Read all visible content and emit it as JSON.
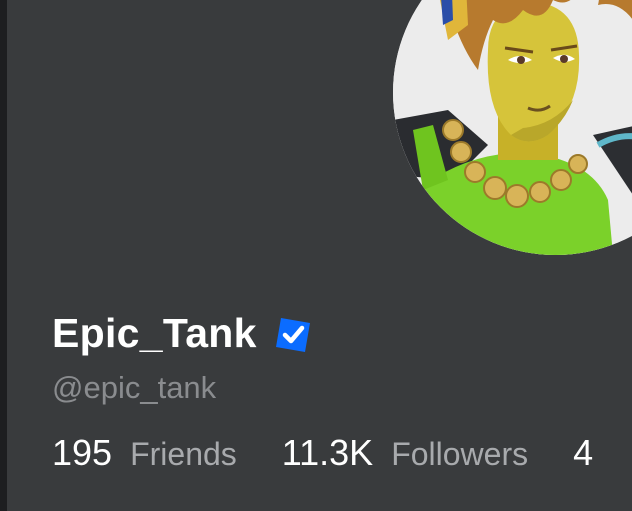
{
  "profile": {
    "display_name": "Epic_Tank",
    "username": "@epic_tank",
    "verified": true,
    "avatar_icon": "avatar-headshot",
    "verified_icon": "verified-badge-icon",
    "colors": {
      "card_bg": "#393b3d",
      "verified_blue": "#0b6cff",
      "name_text": "#ffffff",
      "username_text": "#8a8c8f"
    }
  },
  "stats": [
    {
      "count": "195",
      "label": "Friends"
    },
    {
      "count": "11.3K",
      "label": "Followers"
    },
    {
      "count": "4",
      "label": ""
    }
  ]
}
